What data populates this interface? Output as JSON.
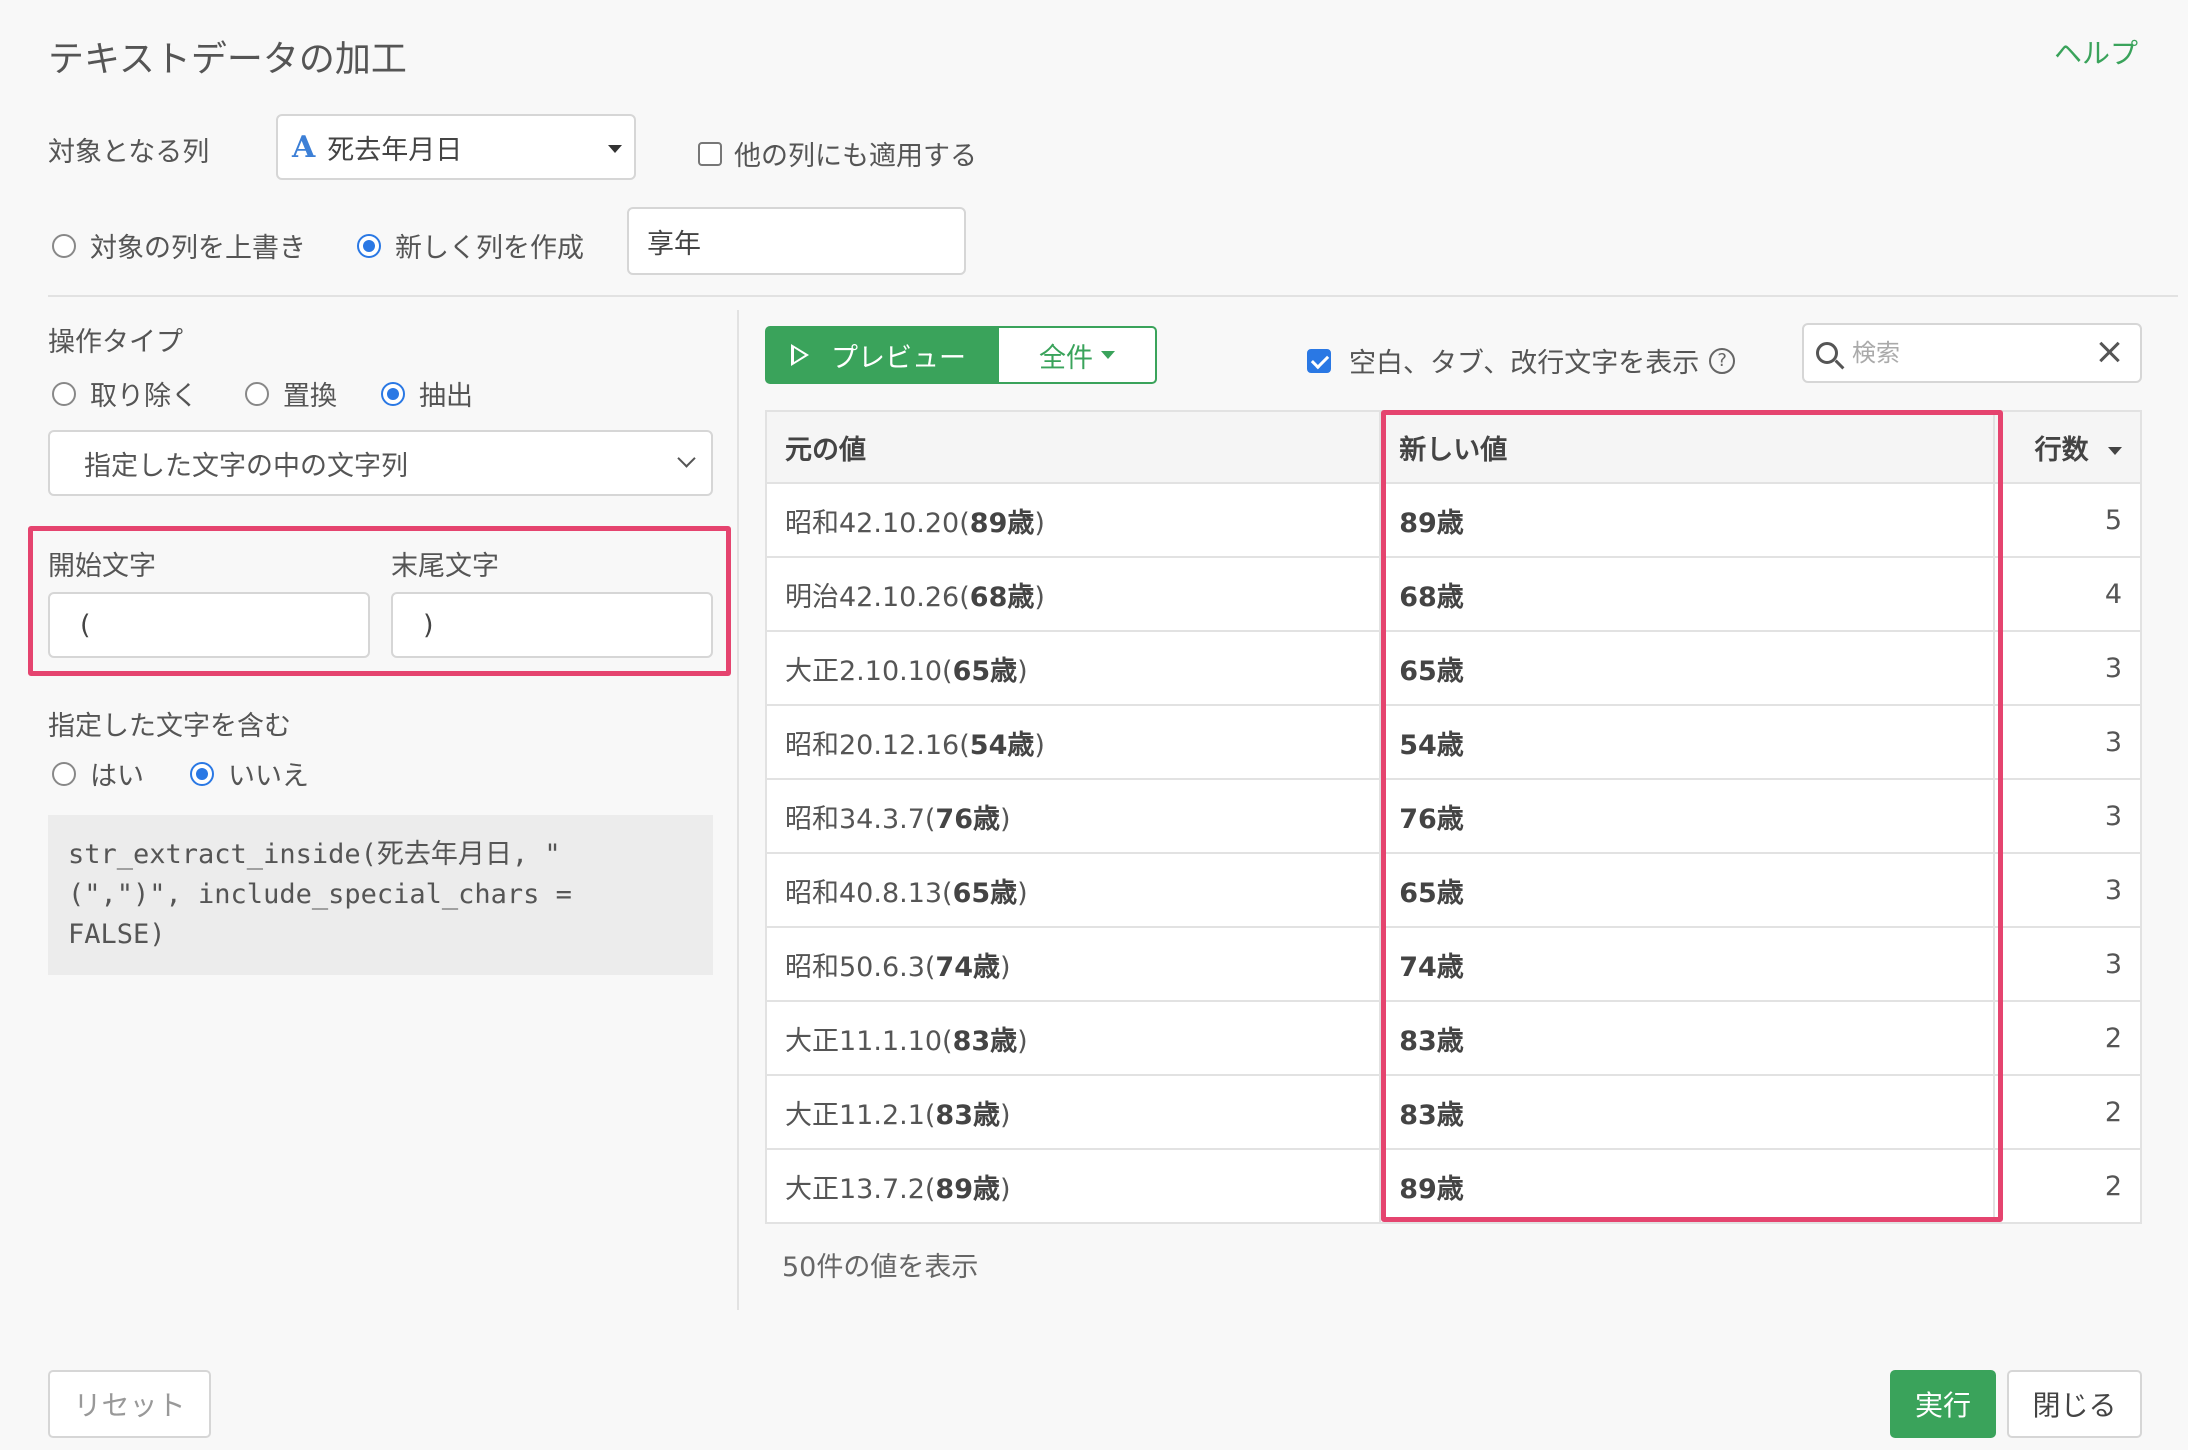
{
  "dialog": {
    "title": "テキストデータの加工",
    "help_label": "ヘルプ"
  },
  "target": {
    "label": "対象となる列",
    "column_type_icon": "A",
    "column_value": "死去年月日",
    "apply_other_label": "他の列にも適用する",
    "apply_other_checked": false
  },
  "output": {
    "overwrite_label": "対象の列を上書き",
    "new_column_label": "新しく列を作成",
    "selected": "new_column",
    "new_column_name": "享年"
  },
  "operation": {
    "label": "操作タイプ",
    "options": [
      "取り除く",
      "置換",
      "抽出"
    ],
    "selected_index": 2,
    "mode_value": "指定した文字の中の文字列",
    "start_label": "開始文字",
    "start_value": "(",
    "end_label": "末尾文字",
    "end_value": ")",
    "include_label": "指定した文字を含む",
    "include_yes": "はい",
    "include_no": "いいえ",
    "include_selected": "no",
    "code": "str_extract_inside(死去年月日, \"\n(\",\")\", include_special_chars =\nFALSE)"
  },
  "preview": {
    "preview_label": "プレビュー",
    "all_label": "全件",
    "show_whitespace_label": "空白、タブ、改行文字を表示",
    "show_whitespace_checked": true,
    "search_placeholder": "検索",
    "columns": {
      "original": "元の値",
      "new": "新しい値",
      "count": "行数"
    },
    "rows": [
      {
        "prefix": "昭和42.10.20(",
        "bold": "89歳",
        "suffix": ")",
        "new": "89歳",
        "count": "5"
      },
      {
        "prefix": "明治42.10.26(",
        "bold": "68歳",
        "suffix": ")",
        "new": "68歳",
        "count": "4"
      },
      {
        "prefix": "大正2.10.10(",
        "bold": "65歳",
        "suffix": ")",
        "new": "65歳",
        "count": "3"
      },
      {
        "prefix": "昭和20.12.16(",
        "bold": "54歳",
        "suffix": ")",
        "new": "54歳",
        "count": "3"
      },
      {
        "prefix": "昭和34.3.7(",
        "bold": "76歳",
        "suffix": ")",
        "new": "76歳",
        "count": "3"
      },
      {
        "prefix": "昭和40.8.13(",
        "bold": "65歳",
        "suffix": ")",
        "new": "65歳",
        "count": "3"
      },
      {
        "prefix": "昭和50.6.3(",
        "bold": "74歳",
        "suffix": ")",
        "new": "74歳",
        "count": "3"
      },
      {
        "prefix": "大正11.1.10(",
        "bold": "83歳",
        "suffix": ")",
        "new": "83歳",
        "count": "2"
      },
      {
        "prefix": "大正11.2.1(",
        "bold": "83歳",
        "suffix": ")",
        "new": "83歳",
        "count": "2"
      },
      {
        "prefix": "大正13.7.2(",
        "bold": "89歳",
        "suffix": ")",
        "new": "89歳",
        "count": "2"
      }
    ],
    "footer": "50件の値を表示"
  },
  "footer": {
    "reset_label": "リセット",
    "run_label": "実行",
    "close_label": "閉じる"
  },
  "colors": {
    "accent_green": "#3aa35b",
    "highlight_pink": "#e5446f",
    "radio_blue": "#2a78e4"
  }
}
